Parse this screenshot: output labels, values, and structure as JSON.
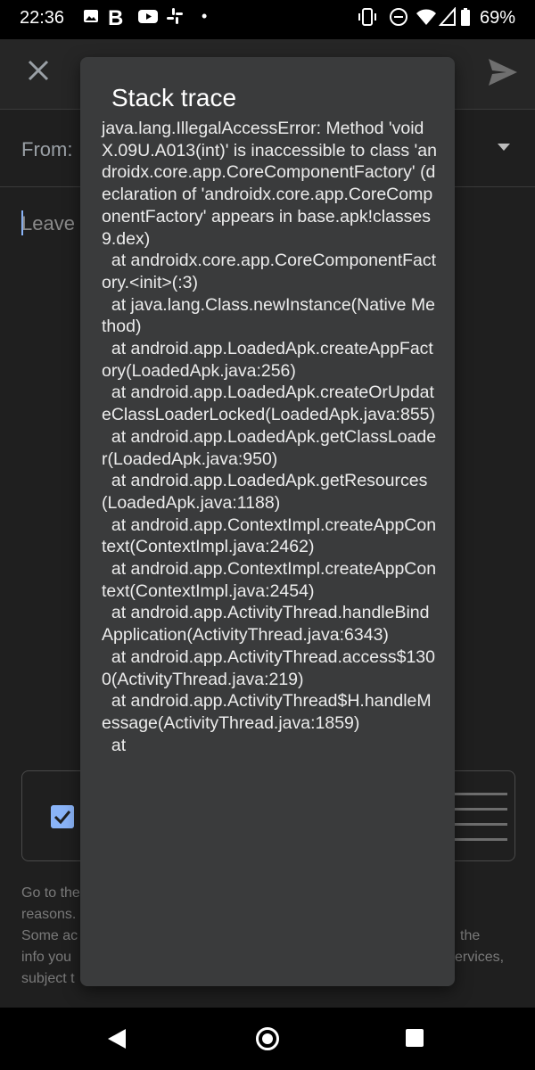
{
  "status_bar": {
    "time": "22:36",
    "battery": "69%",
    "icons": [
      "photo-icon",
      "b-icon",
      "youtube-icon",
      "slack-icon",
      "dot-icon",
      "vibrate-icon",
      "dnd-icon",
      "wifi-icon",
      "signal-icon",
      "battery-icon"
    ]
  },
  "compose": {
    "from_label": "From:",
    "body_placeholder": "Leave",
    "footer_lines": [
      "Go to the",
      "reasons.",
      "Some ac",
      "info you",
      "subject t"
    ],
    "footer_right": [
      "the",
      "ervices,"
    ]
  },
  "dialog": {
    "title": "Stack trace",
    "trace": "java.lang.IllegalAccessError: Method 'void X.09U.A013(int)' is inaccessible to class 'androidx.core.app.CoreComponentFactory' (declaration of 'androidx.core.app.CoreComponentFactory' appears in base.apk!classes9.dex)\n  at androidx.core.app.CoreComponentFactory.<init>(:3)\n  at java.lang.Class.newInstance(Native Method)\n  at android.app.LoadedApk.createAppFactory(LoadedApk.java:256)\n  at android.app.LoadedApk.createOrUpdateClassLoaderLocked(LoadedApk.java:855)\n  at android.app.LoadedApk.getClassLoader(LoadedApk.java:950)\n  at android.app.LoadedApk.getResources(LoadedApk.java:1188)\n  at android.app.ContextImpl.createAppContext(ContextImpl.java:2462)\n  at android.app.ContextImpl.createAppContext(ContextImpl.java:2454)\n  at android.app.ActivityThread.handleBindApplication(ActivityThread.java:6343)\n  at android.app.ActivityThread.access$1300(ActivityThread.java:219)\n  at android.app.ActivityThread$H.handleMessage(ActivityThread.java:1859)\n  at"
  },
  "colors": {
    "dialog_bg": "#3a3b3c",
    "accent": "#8ab4f8"
  }
}
